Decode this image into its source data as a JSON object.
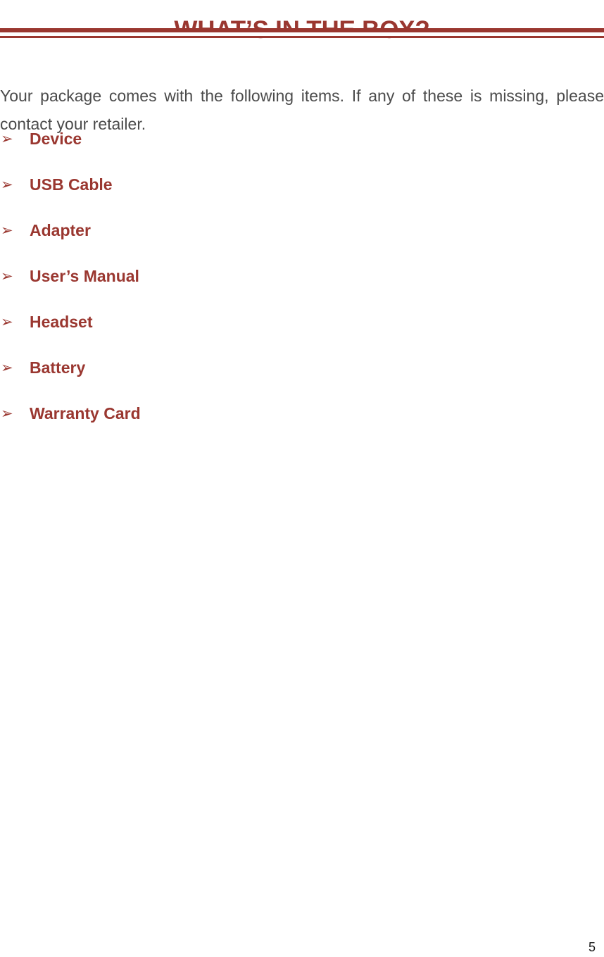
{
  "document": {
    "title": "WHAT’S IN THE BOX?",
    "intro_paragraph": "Your package comes with the following items. If any of these is missing, please contact your retailer.",
    "page_number": "5",
    "bullet_glyph": "➢",
    "colors": {
      "accent": "#9A3730",
      "body_text": "#4B4B4B",
      "page_number_text": "#1A1A1A",
      "background": "#FFFFFF"
    },
    "items": [
      {
        "label": "Device",
        "bullet": "➢"
      },
      {
        "label": "USB Cable",
        "bullet": "➢"
      },
      {
        "label": "Adapter",
        "bullet": "➢"
      },
      {
        "label": "User’s Manual",
        "bullet": "➢"
      },
      {
        "label": "Headset",
        "bullet": "➢"
      },
      {
        "label": "Battery",
        "bullet": "➢"
      },
      {
        "label": "Warranty Card",
        "bullet": "➢"
      }
    ]
  }
}
